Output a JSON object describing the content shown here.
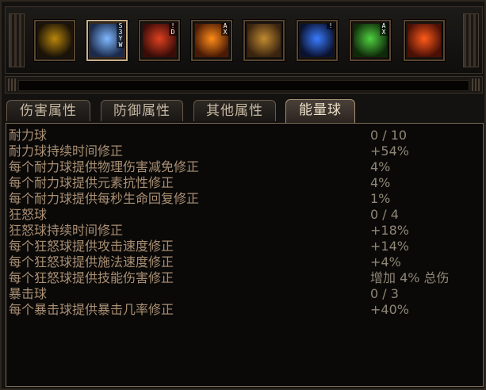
{
  "skills": [
    {
      "name": "sword-skill",
      "tag": "",
      "colors": [
        "#b8860b",
        "#1a1208"
      ]
    },
    {
      "name": "blue-burst-skill",
      "tag": "S\n3\nY\nW",
      "colors": [
        "#7fb8ff",
        "#1b2a4a"
      ],
      "selected": true
    },
    {
      "name": "red-demon-skill",
      "tag": "!\nD",
      "colors": [
        "#e04020",
        "#3a0c08"
      ]
    },
    {
      "name": "fire-warrior-skill",
      "tag": "A\nX",
      "colors": [
        "#ff8c1a",
        "#4a1a05"
      ]
    },
    {
      "name": "golden-spiral-skill",
      "tag": "",
      "colors": [
        "#c08a30",
        "#3a2410"
      ]
    },
    {
      "name": "blue-vortex-skill",
      "tag": "!",
      "colors": [
        "#3a7cff",
        "#0a1230"
      ]
    },
    {
      "name": "green-totem-skill",
      "tag": "A\nX",
      "colors": [
        "#4fd040",
        "#0f2a0a"
      ]
    },
    {
      "name": "fire-rune-skill",
      "tag": "",
      "colors": [
        "#ff5a1a",
        "#4a1006"
      ]
    }
  ],
  "tabs": [
    {
      "label": "伤害属性",
      "active": false
    },
    {
      "label": "防御属性",
      "active": false
    },
    {
      "label": "其他属性",
      "active": false
    },
    {
      "label": "能量球",
      "active": true
    }
  ],
  "stats": [
    {
      "label": "耐力球",
      "value": "0 / 10"
    },
    {
      "label": "耐力球持续时间修正",
      "value": "+54%"
    },
    {
      "label": "每个耐力球提供物理伤害减免修正",
      "value": "4%"
    },
    {
      "label": "每个耐力球提供元素抗性修正",
      "value": "4%"
    },
    {
      "label": "每个耐力球提供每秒生命回复修正",
      "value": "1%"
    },
    {
      "label": "狂怒球",
      "value": "0 / 4"
    },
    {
      "label": "狂怒球持续时间修正",
      "value": "+18%"
    },
    {
      "label": "每个狂怒球提供攻击速度修正",
      "value": "+14%"
    },
    {
      "label": "每个狂怒球提供施法速度修正",
      "value": "+4%"
    },
    {
      "label": "每个狂怒球提供技能伤害修正",
      "value": "增加 4% 总伤"
    },
    {
      "label": "暴击球",
      "value": "0 / 3"
    },
    {
      "label": "每个暴击球提供暴击几率修正",
      "value": "+40%"
    }
  ]
}
